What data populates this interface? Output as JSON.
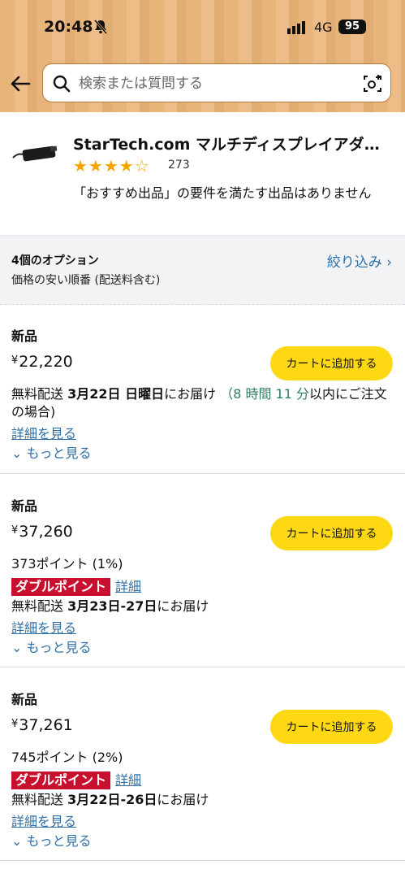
{
  "status": {
    "time": "20:48",
    "network": "4G",
    "battery": "95"
  },
  "search": {
    "placeholder": "検索または質問する"
  },
  "product": {
    "title": "StarTech.com マルチディスプレイアダプ…",
    "stars": "★★★★☆",
    "rating_value": 4.0,
    "review_count": "273",
    "note": "「おすすめ出品」の要件を満たす出品はありません"
  },
  "filter": {
    "option_count": "4個のオプション",
    "sort_label": "価格の安い順番 (配送料含む)",
    "filter_link": "絞り込み ›"
  },
  "offers": [
    {
      "condition": "新品",
      "yen": "¥",
      "price": "22,220",
      "cart_label": "カートに追加する",
      "delivery_prefix": "無料配送 ",
      "delivery_date": "3月22日 日曜日",
      "delivery_suffix": "にお届け",
      "order_open": "（",
      "hours": "8 時間 11 分",
      "order_tail": "以内にご注文の場合)",
      "details_link": "詳細を見る",
      "more_link": "⌄ もっと見る"
    },
    {
      "condition": "新品",
      "yen": "¥",
      "price": "37,260",
      "cart_label": "カートに追加する",
      "points": "373ポイント (1%)",
      "badge": "ダブルポイント",
      "badge_detail": "詳細",
      "delivery_prefix": "無料配送 ",
      "delivery_date": "3月23日-27日",
      "delivery_suffix": "にお届け",
      "details_link": "詳細を見る",
      "more_link": "⌄ もっと見る"
    },
    {
      "condition": "新品",
      "yen": "¥",
      "price": "37,261",
      "cart_label": "カートに追加する",
      "points": "745ポイント (2%)",
      "badge": "ダブルポイント",
      "badge_detail": "詳細",
      "delivery_prefix": "無料配送 ",
      "delivery_date": "3月22日-26日",
      "delivery_suffix": "にお届け",
      "details_link": "詳細を見る",
      "more_link": "⌄ もっと見る"
    }
  ],
  "colors": {
    "accent_yellow": "#ffd814",
    "link_blue": "#2f6fa6",
    "badge_red": "#c8102e",
    "star_orange": "#f5a300",
    "timer_green": "#2e7d5b"
  }
}
